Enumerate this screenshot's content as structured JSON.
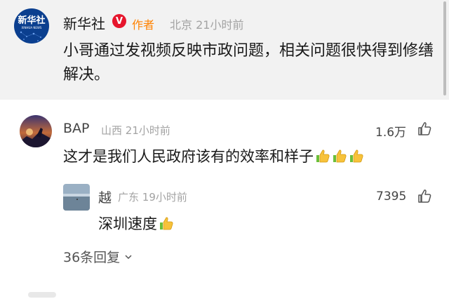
{
  "post": {
    "author": "新华社",
    "author_tag": "作者",
    "location": "北京",
    "time": "21小时前",
    "text": "小哥通过发视频反映市政问题，相关问题很快得到修缮解决。",
    "avatar_text": "新华社",
    "avatar_subtext": "XINHUA NEWS",
    "verified_badge": "V"
  },
  "comment": {
    "user": "BAP",
    "location": "山西",
    "time": "21小时前",
    "likes": "1.6万",
    "text": "这才是我们人民政府该有的效率和样子",
    "emoji_count": 3
  },
  "reply": {
    "user": "越",
    "location": "广东",
    "time": "19小时前",
    "likes": "7395",
    "text": "深圳速度",
    "emoji_count": 1
  },
  "more_replies": "36条回复",
  "colors": {
    "accent_orange": "#ff8200",
    "verified_red": "#e6162d",
    "meta_gray": "#a3a3a3",
    "post_bg": "#f2f2f2",
    "brand_blue": "#0b3f8f"
  }
}
